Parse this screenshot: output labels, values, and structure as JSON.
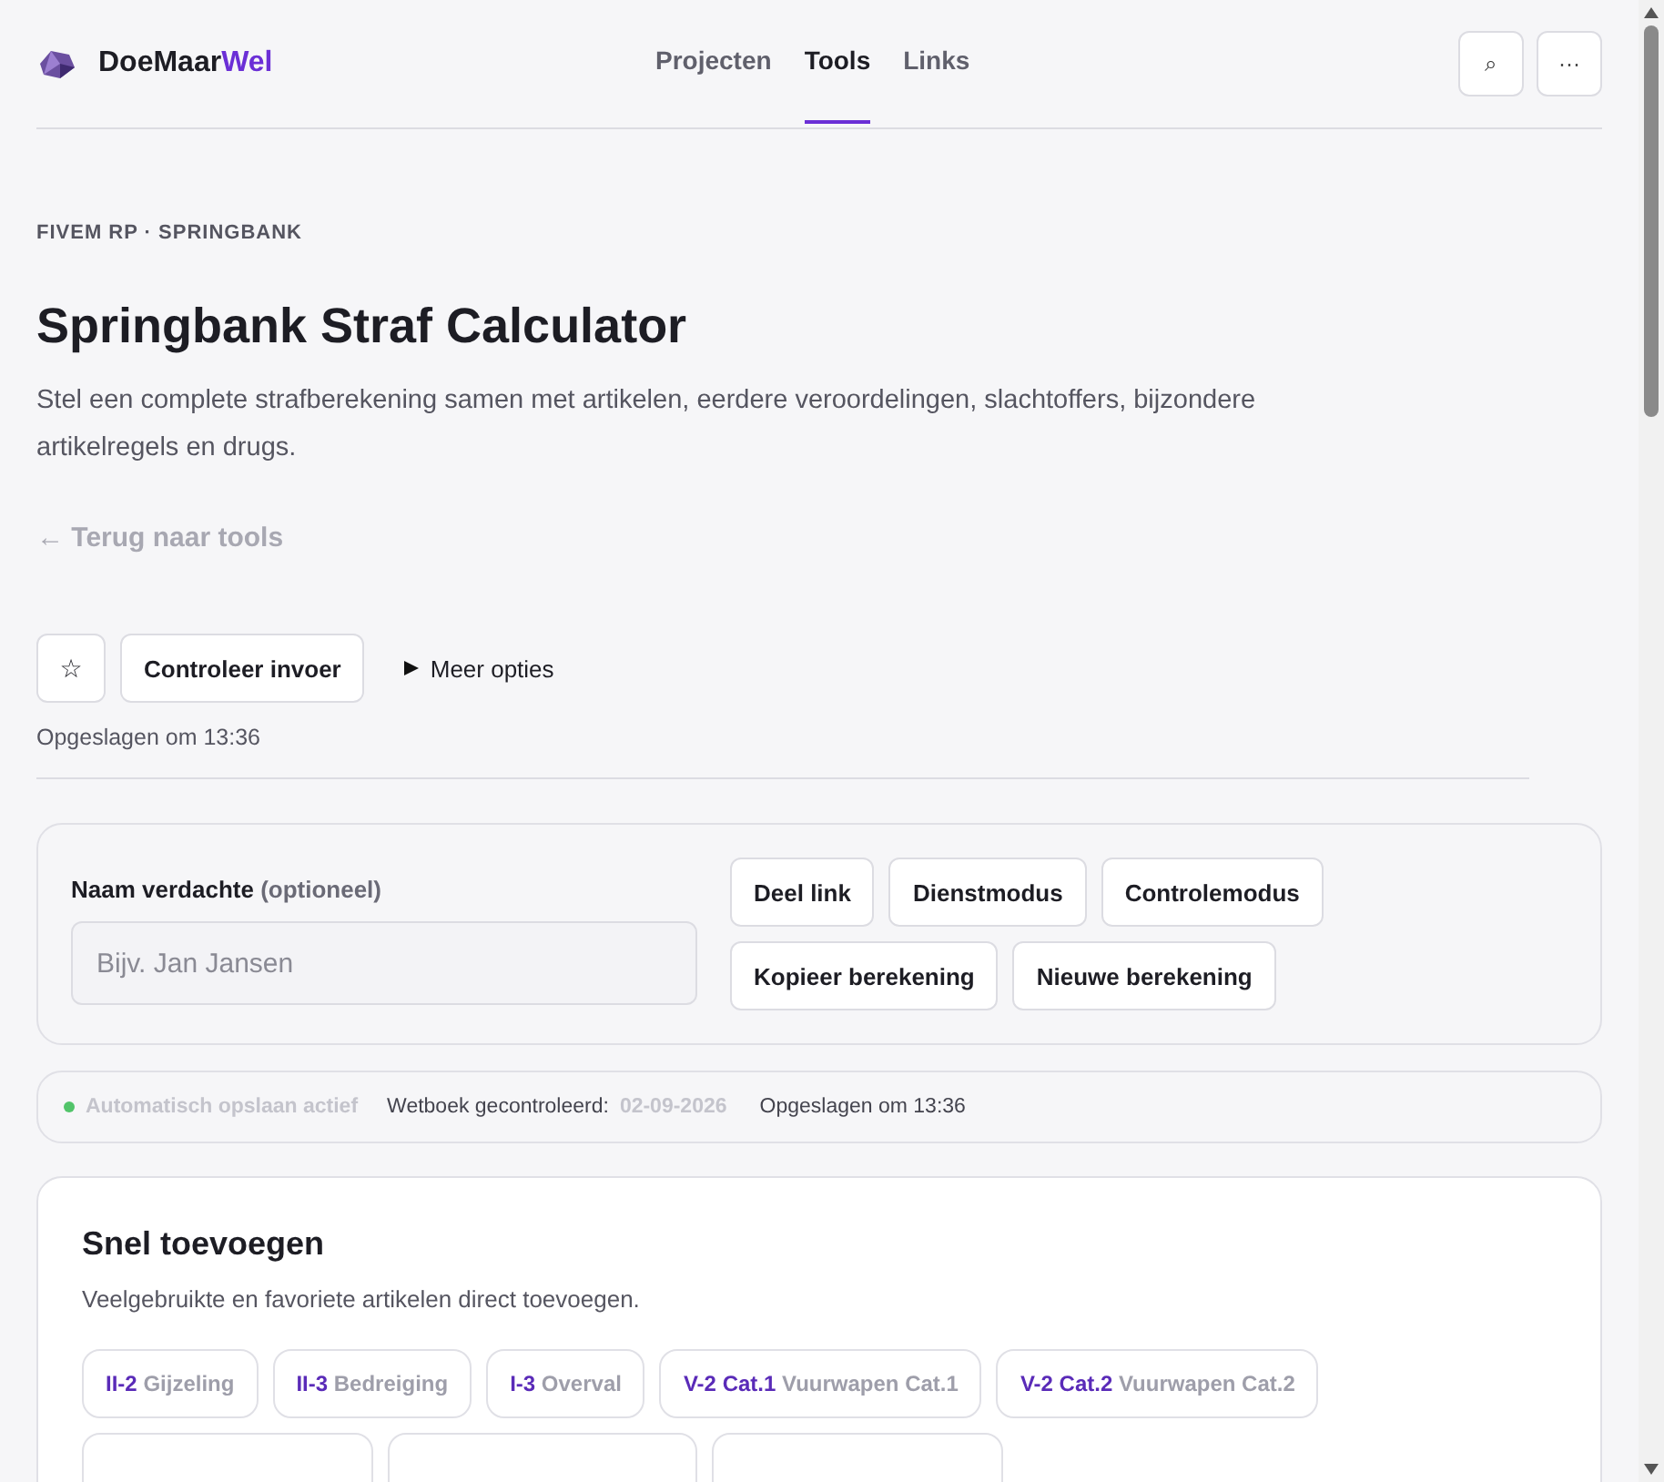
{
  "header": {
    "logo": {
      "prefix": "DoeMaar",
      "accent": "Wel"
    },
    "nav": [
      {
        "label": "Projecten",
        "selected": false
      },
      {
        "label": "Tools",
        "selected": true
      },
      {
        "label": "Links",
        "selected": false
      }
    ],
    "buttons": [
      "⌕",
      "···"
    ]
  },
  "eyebrow": "FIVEM RP · SPRINGBANK",
  "title": "Springbank Straf Calculator",
  "intro": "Stel een complete strafberekening samen met artikelen, eerdere veroordelingen, slachtoffers, bijzondere artikelregels en drugs.",
  "back_link": "← Terug naar tools",
  "toolbar": {
    "star": "☆",
    "check": "Controleer invoer",
    "more": "Meer opties",
    "more_expanded": false,
    "saved": "Opgeslagen om 13:36"
  },
  "suspect": {
    "label": "Naam verdachte",
    "hint": "(optioneel)",
    "placeholder": "Bijv. Jan Jansen",
    "actions": [
      "Deel link",
      "Dienstmodus",
      "Controlemodus",
      "Kopieer berekening",
      "Nieuwe berekening"
    ]
  },
  "status": {
    "autosave": "Automatisch opslaan actief",
    "autosave_on": true,
    "lawbook_label": "Wetboek gecontroleerd:",
    "lawbook_date": "02-09-2026",
    "saved": "Opgeslagen om 13:36"
  },
  "quick_add": {
    "title": "Snel toevoegen",
    "subtitle": "Veelgebruikte en favoriete artikelen direct toevoegen.",
    "chips": [
      {
        "kind": "article",
        "code": "II-2",
        "name": "Gijzeling"
      },
      {
        "kind": "article",
        "code": "II-3",
        "name": "Bedreiging"
      },
      {
        "kind": "article",
        "code": "I-3",
        "name": "Overval"
      },
      {
        "kind": "article",
        "code": "V-2 Cat.1",
        "name": "Vuurwapen Cat.1"
      },
      {
        "kind": "article",
        "code": "V-2 Cat.2",
        "name": "Vuurwapen Cat.2"
      },
      {
        "kind": "cut"
      },
      {
        "kind": "cut"
      },
      {
        "kind": "cut"
      }
    ]
  }
}
